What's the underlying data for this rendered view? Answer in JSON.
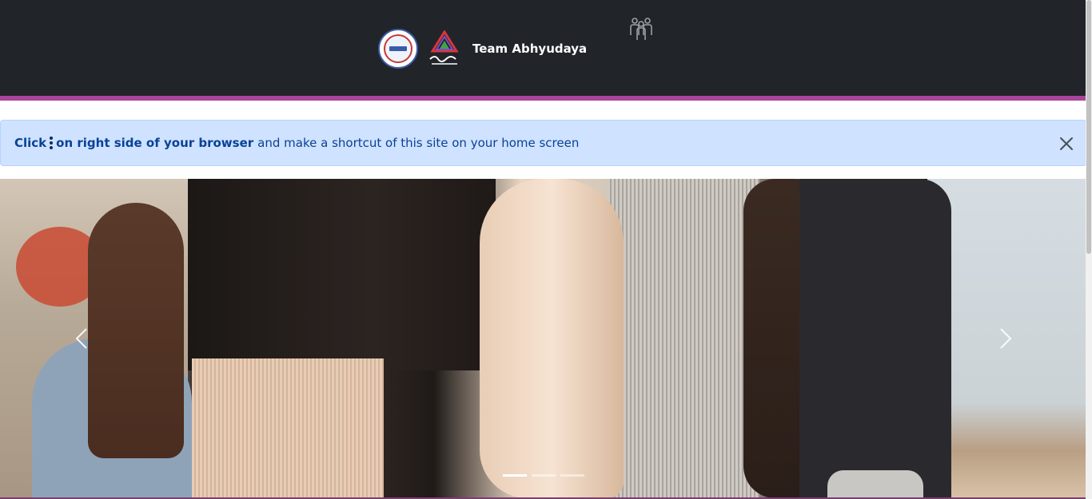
{
  "navbar": {
    "brand_title": "Team Abhyudaya",
    "logos": [
      "college-logo",
      "abhyudaya-logo"
    ],
    "team_icon": "team-icon",
    "accent_color": "#a8449b",
    "background_color": "#212529"
  },
  "alert": {
    "bold_prefix": "Click",
    "kebab_icon": "kebab-menu-icon",
    "bold_suffix": "on right side of your browser",
    "message": "and make a shortcut of this site on your home screen",
    "close_icon": "close-icon",
    "background_color": "#cfe2ff",
    "text_color": "#084298"
  },
  "carousel": {
    "prev_icon": "chevron-left-icon",
    "next_icon": "chevron-right-icon",
    "slide_count": 3,
    "active_slide": 1
  }
}
